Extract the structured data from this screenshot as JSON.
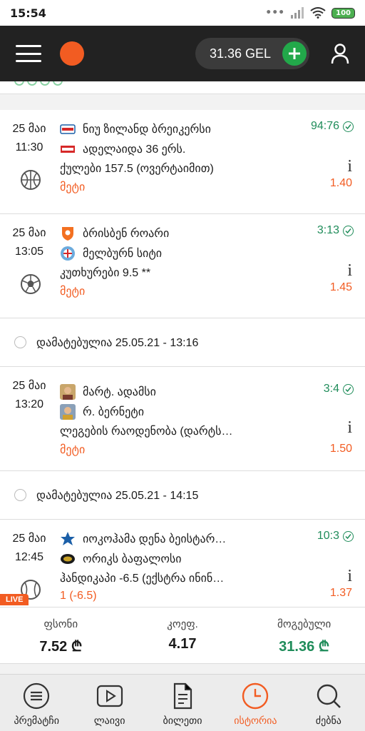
{
  "status_bar": {
    "time": "15:54",
    "battery": "100"
  },
  "app_bar": {
    "balance": "31.36 GEL"
  },
  "bets": [
    {
      "date": "25 მაი",
      "time": "11:30",
      "sport": "basketball",
      "team1": "ნიუ ზილანდ ბრეიკერსი",
      "team2": "ადელაიდა 36 ერს.",
      "market": "ქულები 157.5 (ოვერტაიმით)",
      "pick": "მეტი",
      "score": "94:76",
      "odds": "1.40"
    },
    {
      "date": "25 მაი",
      "time": "13:05",
      "sport": "football",
      "team1": "ბრისბენ როარი",
      "team2": "მელბურნ სიტი",
      "market": "კუთხურები 9.5 **",
      "pick": "მეტი",
      "score": "3:13",
      "odds": "1.45"
    },
    {
      "date": "25 მაი",
      "time": "13:20",
      "sport": "darts",
      "team1": "მარტ. ადამსი",
      "team2": "რ. ბერნეტი",
      "market": "ლეგების რაოდენობა (დარტს…",
      "pick": "მეტი",
      "score": "3:4",
      "odds": "1.50"
    },
    {
      "date": "25 მაი",
      "time": "12:45",
      "sport": "baseball",
      "team1": "იოკოჰამა დენა ბეისტარ…",
      "team2": "ორიკს ბაფალოსი",
      "market": "ჰანდიკაპი -6.5 (ექსტრა ინინ…",
      "pick": "1 (-6.5)",
      "score": "10:3",
      "odds": "1.37"
    }
  ],
  "added_rows": [
    {
      "text": "დამატებულია 25.05.21 - 13:16"
    },
    {
      "text": "დამატებულია 25.05.21 - 14:15"
    }
  ],
  "live_tag": "LIVE",
  "summary": {
    "stake_label": "ფსონი",
    "stake_value": "7.52 ₾",
    "coef_label": "კოეფ.",
    "coef_value": "4.17",
    "win_label": "მოგებული",
    "win_value": "31.36 ₾"
  },
  "nav": [
    {
      "label": "პრემატჩი",
      "icon": "menu-circle-icon"
    },
    {
      "label": "ლაივი",
      "icon": "play-icon"
    },
    {
      "label": "ბილეთი",
      "icon": "ticket-icon"
    },
    {
      "label": "ისტორია",
      "icon": "clock-icon",
      "active": true
    },
    {
      "label": "ძებნა",
      "icon": "search-icon"
    }
  ],
  "colors": {
    "accent": "#f25c22",
    "win_green": "#1f8c5a",
    "appbar": "#222222"
  }
}
